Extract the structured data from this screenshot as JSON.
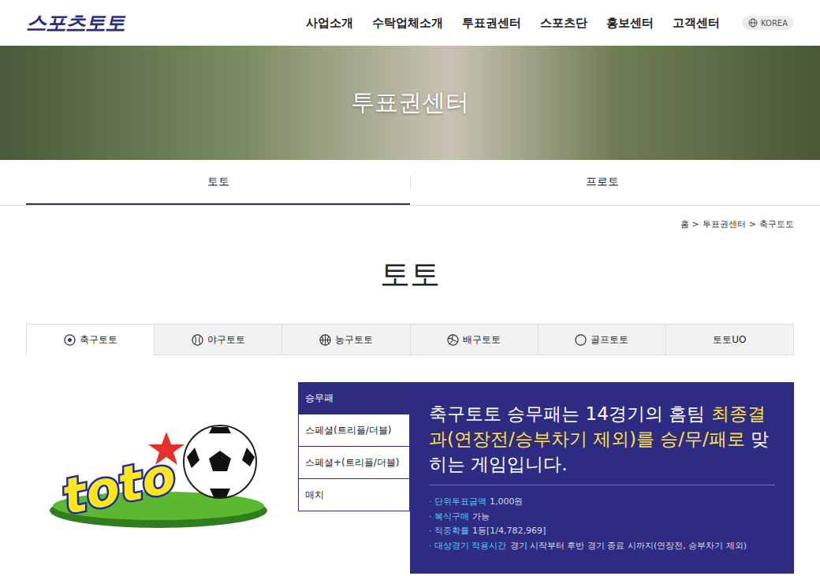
{
  "header": {
    "logo": "스포츠토토",
    "nav": [
      "사업소개",
      "수탁업체소개",
      "투표권센터",
      "스포츠단",
      "홍보센터",
      "고객센터"
    ],
    "language": "KOREA"
  },
  "hero": {
    "title": "투표권센터"
  },
  "main_tabs": [
    {
      "label": "토토",
      "selected": true
    },
    {
      "label": "프로토",
      "selected": false
    }
  ],
  "breadcrumb": {
    "items": [
      "홈",
      "투표권센터",
      "축구토토"
    ],
    "separator": ">"
  },
  "page_title": "토토",
  "sport_tabs": [
    {
      "label": "축구토토",
      "selected": true
    },
    {
      "label": "야구토토",
      "selected": false
    },
    {
      "label": "농구토토",
      "selected": false
    },
    {
      "label": "배구토토",
      "selected": false
    },
    {
      "label": "골프토토",
      "selected": false
    },
    {
      "label": "토토UO",
      "selected": false
    }
  ],
  "logo_text": "toto",
  "game_menu": [
    {
      "label": "승무패",
      "selected": true
    },
    {
      "label": "스페셜(트리플/더블)",
      "selected": false
    },
    {
      "label": "스페셜+(트리플/더블)",
      "selected": false
    },
    {
      "label": "매치",
      "selected": false
    }
  ],
  "description": [
    {
      "text": "축구토토 승무패는 14경기의 홈팀 ",
      "highlight": false
    },
    {
      "text": "최종결과(연장전/승부차기 제외)를 승/무/패로",
      "highlight": true
    },
    {
      "text": " 맞히는 게임입니다.",
      "highlight": false
    }
  ],
  "info": {
    "bullet": "·",
    "items": [
      {
        "label": "단위투표금액",
        "value": "1,000원"
      },
      {
        "label": "복식구매",
        "value": "가능"
      },
      {
        "label": "적중확률",
        "value": "1등[1/4,782,969]"
      },
      {
        "label": "대상경기 적용시간",
        "value": "경기 시작부터 후반 경기 종료 시까지(연장전, 승부차기 제외)"
      }
    ]
  }
}
